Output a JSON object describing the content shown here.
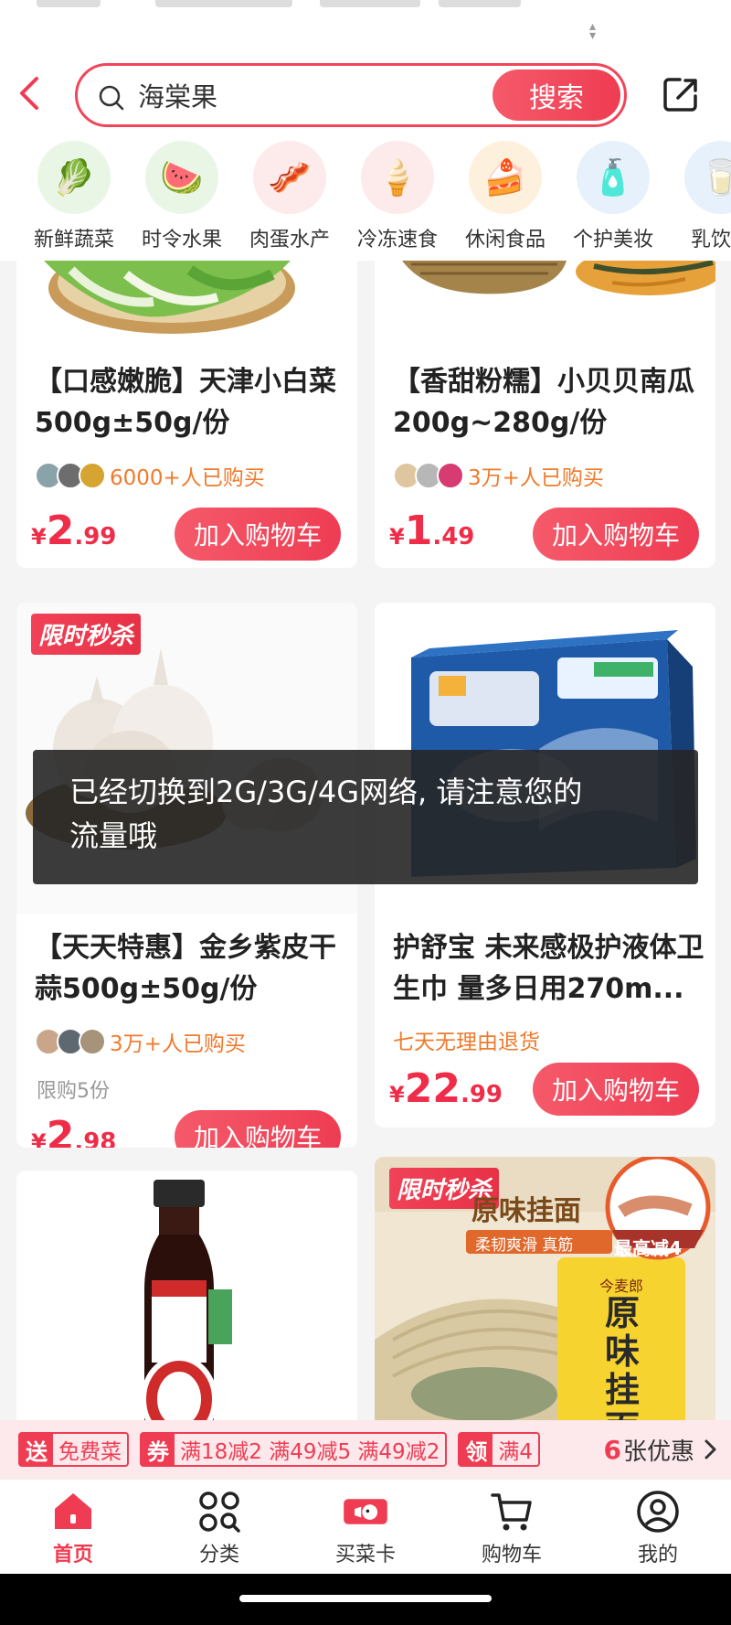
{
  "header": {
    "search_value": "海棠果",
    "search_button": "搜索"
  },
  "categories": [
    {
      "label": "新鲜蔬菜",
      "icon": "vegetable-icon"
    },
    {
      "label": "时令水果",
      "icon": "fruit-icon"
    },
    {
      "label": "肉蛋水产",
      "icon": "meat-icon"
    },
    {
      "label": "冷冻速食",
      "icon": "frozen-food-icon"
    },
    {
      "label": "休闲食品",
      "icon": "snack-icon"
    },
    {
      "label": "个护美妆",
      "icon": "personal-care-icon"
    },
    {
      "label": "乳饮酒",
      "icon": "dairy-drink-icon"
    }
  ],
  "products": [
    {
      "title": "【口感嫩脆】天津小白菜500g±50g/份",
      "buyers": "6000+人已购买",
      "price_symbol": "¥",
      "price_int": "2",
      "price_dec": ".99",
      "button": "加入购物车"
    },
    {
      "title": "【香甜粉糯】小贝贝南瓜 200g~280g/份",
      "buyers": "3万+人已购买",
      "price_symbol": "¥",
      "price_int": "1",
      "price_dec": ".49",
      "button": "加入购物车"
    },
    {
      "tag": "限时秒杀",
      "title": "【天天特惠】金乡紫皮干蒜500g±50g/份",
      "buyers": "3万+人已购买",
      "limit": "限购5份",
      "price_symbol": "¥",
      "price_int": "2",
      "price_dec": ".98",
      "button": "加入购物车"
    },
    {
      "title": "护舒宝 未来感极护液体卫生巾 量多日用270m...",
      "returns": "七天无理由退货",
      "price_symbol": "¥",
      "price_int": "22",
      "price_dec": ".99",
      "button": "加入购物车"
    },
    {
      "title": "",
      "note": "soy sauce product (image only)"
    },
    {
      "tag": "限时秒杀",
      "image_text": {
        "headline": "原味挂面",
        "sub": "柔韧爽滑 真筋",
        "badge": "最高减4",
        "brand": "今麦郎",
        "pack_name": "原味挂面"
      }
    }
  ],
  "toast": {
    "line1": "已经切换到2G/3G/4G网络, 请注意您的",
    "line2": "流量哦"
  },
  "promo_bar": {
    "chip1_tag": "送",
    "chip1_text": "免费菜",
    "chip2_tag": "券",
    "chip2_text": "满18减2  满49减5  满49减2",
    "chip3_tag": "领",
    "chip3_text": "满4",
    "more_count": "6",
    "more_text": "张优惠"
  },
  "nav": [
    {
      "label": "首页",
      "icon": "home-icon",
      "active": true
    },
    {
      "label": "分类",
      "icon": "category-icon"
    },
    {
      "label": "买菜卡",
      "icon": "card-icon"
    },
    {
      "label": "购物车",
      "icon": "cart-icon"
    },
    {
      "label": "我的",
      "icon": "profile-icon"
    }
  ],
  "colors": {
    "accent": "#ef3c52",
    "orange_text": "#f07a2b"
  }
}
